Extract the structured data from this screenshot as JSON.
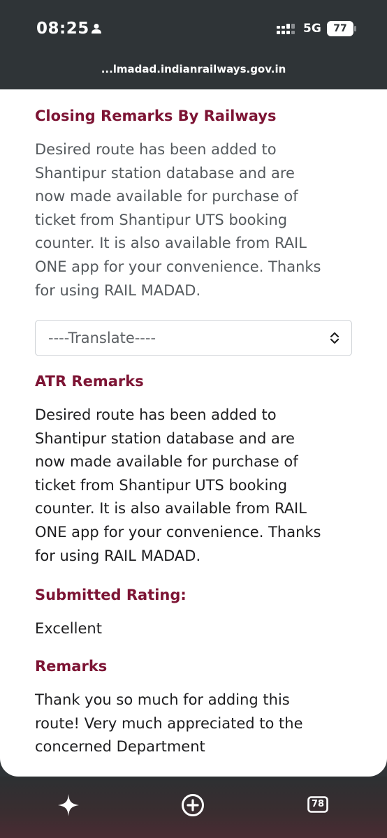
{
  "status_bar": {
    "time": "08:25",
    "network": "5G",
    "battery": "77"
  },
  "url_bar": {
    "url": "...lmadad.indianrailways.gov.in"
  },
  "closing_remarks": {
    "title": "Closing Remarks By Railways",
    "text": "Desired route has been added to\nShantipur station database and are\nnow made available for purchase of\nticket from Shantipur UTS booking\ncounter. It is also available from RAIL\nONE app for your convenience. Thanks\nfor using RAIL MADAD."
  },
  "translate_select": {
    "selected": "----Translate----"
  },
  "atr_remarks": {
    "title": "ATR Remarks",
    "text": "Desired route has been added to\nShantipur station database and are\nnow made available for purchase of\nticket from Shantipur UTS booking\ncounter. It is also available from RAIL\nONE app for your convenience. Thanks\nfor using RAIL MADAD."
  },
  "submitted_rating": {
    "title": "Submitted Rating:",
    "value": "Excellent"
  },
  "remarks": {
    "title": "Remarks",
    "text": "Thank you so much for adding this\nroute! Very much appreciated to the\nconcerned Department"
  },
  "bottom_nav": {
    "tab_count": "78"
  },
  "colors": {
    "heading": "#7d1434",
    "status_bar_bg": "#2f3437",
    "body_text": "#555a5e"
  }
}
